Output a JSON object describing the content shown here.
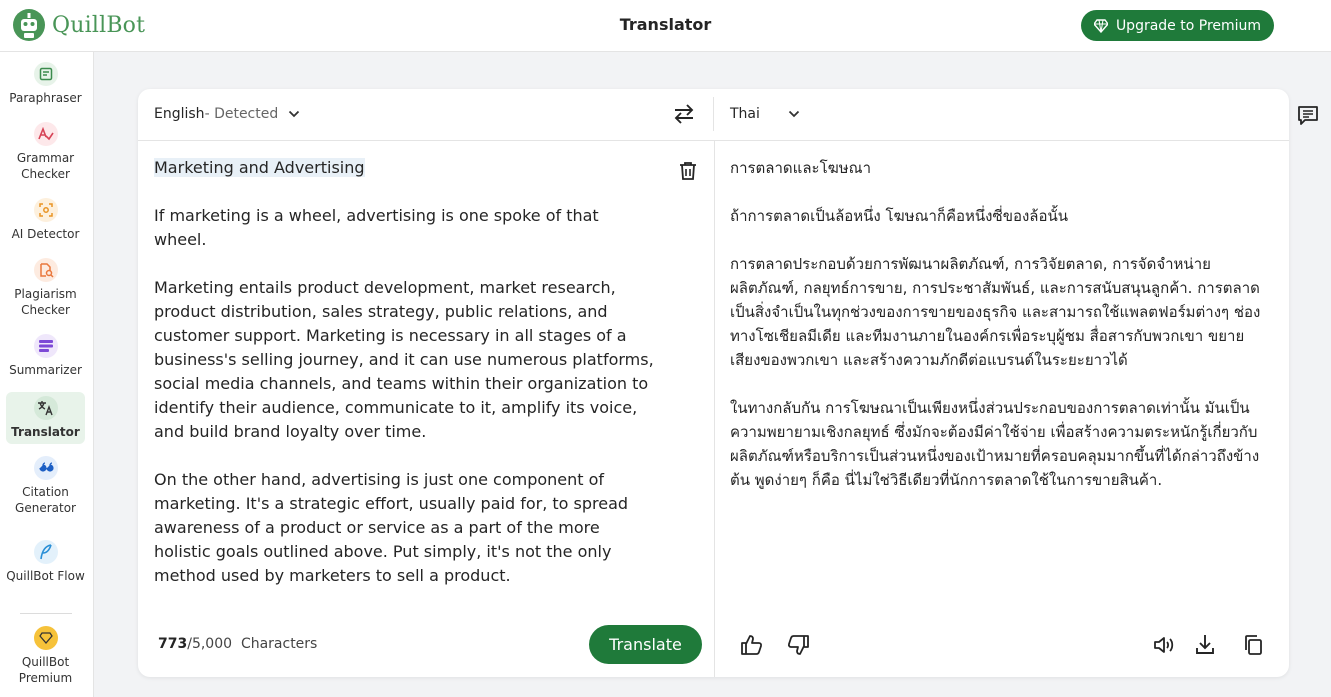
{
  "app": {
    "logo_text": "QuillBot",
    "page_title": "Translator",
    "upgrade_label": "Upgrade to Premium",
    "brand_color": "#499557",
    "accent_color": "#1f7a3a"
  },
  "sidebar": {
    "items": [
      {
        "label": "Paraphraser",
        "icon": "paraphraser-icon"
      },
      {
        "label": "Grammar Checker",
        "icon": "grammar-checker-icon"
      },
      {
        "label": "AI Detector",
        "icon": "ai-detector-icon"
      },
      {
        "label": "Plagiarism Checker",
        "icon": "plagiarism-checker-icon"
      },
      {
        "label": "Summarizer",
        "icon": "summarizer-icon"
      },
      {
        "label": "Translator",
        "icon": "translator-icon",
        "active": true
      },
      {
        "label": "Citation Generator",
        "icon": "citation-generator-icon"
      },
      {
        "label": "QuillBot Flow",
        "icon": "flow-icon"
      },
      {
        "label": "QuillBot Premium",
        "icon": "premium-gem-icon"
      }
    ]
  },
  "translator": {
    "source_lang": "English",
    "source_detected": " - Detected",
    "target_lang": "Thai",
    "source_paragraphs": [
      "Marketing and Advertising",
      "If marketing is a wheel, advertising is one spoke of that wheel.",
      "Marketing entails product development, market research, product distribution, sales strategy, public relations, and customer support. Marketing is necessary in all stages of a business's selling journey, and it can use numerous platforms, social media channels, and teams within their organization to identify their audience, communicate to it, amplify its voice, and build brand loyalty over time.",
      "On the other hand, advertising is just one component of marketing. It's a strategic effort, usually paid for, to spread awareness of a product or service as a part of the more holistic goals outlined above. Put simply, it's not the only method used by marketers to sell a product."
    ],
    "target_paragraphs": [
      "การตลาดและโฆษณา",
      "ถ้าการตลาดเป็นล้อหนึ่ง โฆษณาก็คือหนึ่งซี่ของล้อนั้น",
      "การตลาดประกอบด้วยการพัฒนาผลิตภัณฑ์, การวิจัยตลาด, การจัดจำหน่ายผลิตภัณฑ์, กลยุทธ์การขาย, การประชาสัมพันธ์, และการสนับสนุนลูกค้า. การตลาดเป็นสิ่งจำเป็นในทุกช่วงของการขายของธุรกิจ และสามารถใช้แพลตฟอร์มต่างๆ ช่องทางโซเชียลมีเดีย และทีมงานภายในองค์กรเพื่อระบุผู้ชม สื่อสารกับพวกเขา ขยายเสียงของพวกเขา และสร้างความภักดีต่อแบรนด์ในระยะยาวได้",
      "ในทางกลับกัน การโฆษณาเป็นเพียงหนึ่งส่วนประกอบของการตลาดเท่านั้น มันเป็นความพยายามเชิงกลยุทธ์ ซึ่งมักจะต้องมีค่าใช้จ่าย เพื่อสร้างความตระหนักรู้เกี่ยวกับผลิตภัณฑ์หรือบริการเป็นส่วนหนึ่งของเป้าหมายที่ครอบคลุมมากขึ้นที่ได้กล่าวถึงข้างต้น พูดง่ายๆ ก็คือ นี่ไม่ใช่วิธีเดียวที่นักการตลาดใช้ในการขายสินค้า."
    ],
    "char_count": "773",
    "char_limit": "/5,000",
    "char_label": "Characters",
    "translate_label": "Translate"
  }
}
